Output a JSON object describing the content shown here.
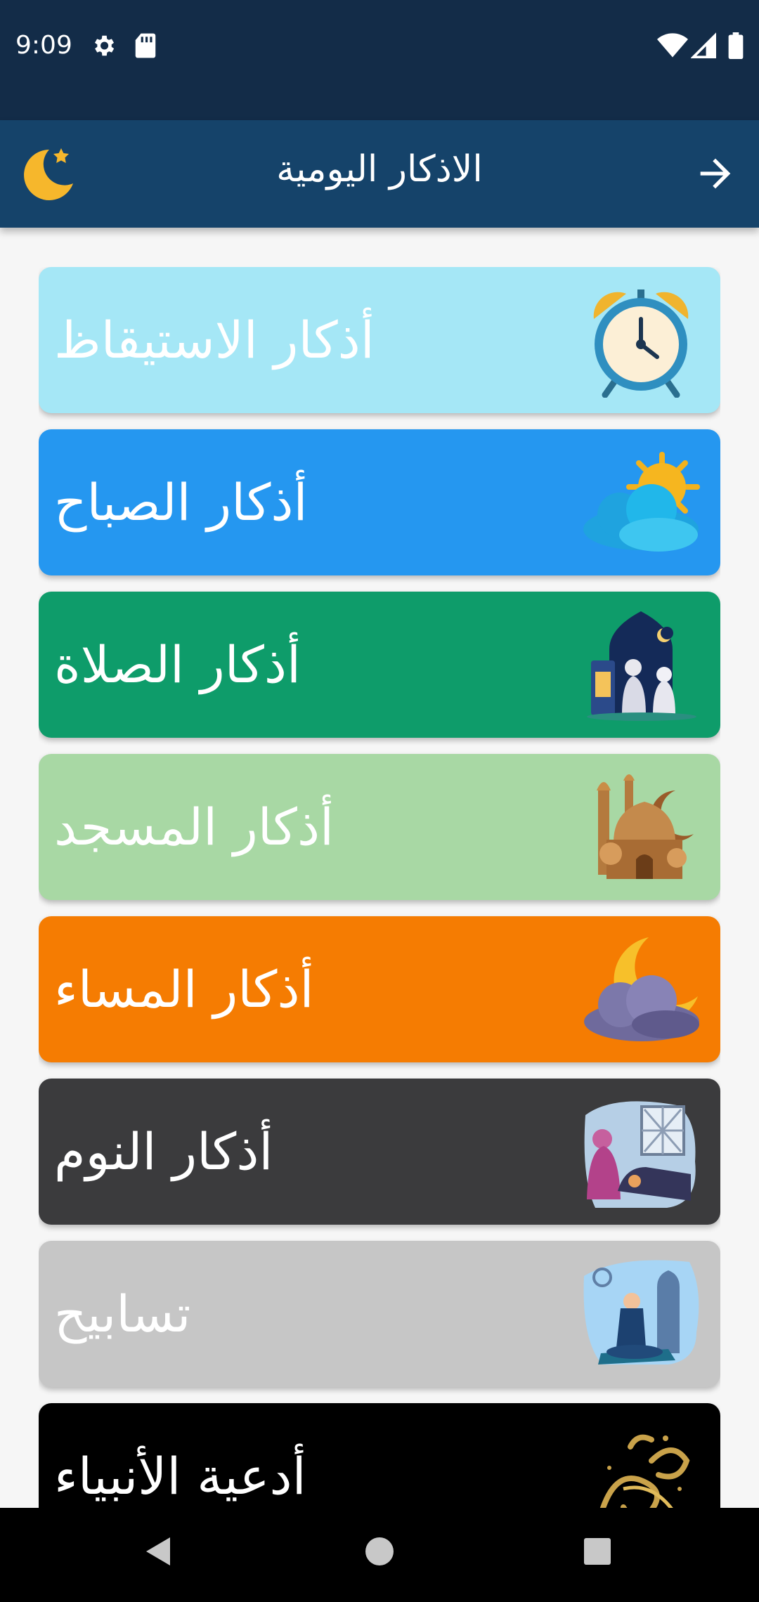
{
  "status_bar": {
    "time": "9:09",
    "icons": [
      "gear-icon",
      "sd-card-icon",
      "wifi-icon",
      "cellular-signal-icon",
      "battery-icon"
    ]
  },
  "app_bar": {
    "title": "الاذكار اليومية",
    "back_icon": "arrow-right-icon",
    "menu_icon": "crescent-star-icon",
    "background": "#15436a"
  },
  "categories": [
    {
      "label": "أذكار الاستيقاظ",
      "color": "#a5e7f6",
      "icon": "alarm-clock-icon"
    },
    {
      "label": "أذكار الصباح",
      "color": "#2597f0",
      "icon": "sun-cloud-icon"
    },
    {
      "label": "أذكار الصلاة",
      "color": "#0e9c6a",
      "icon": "praying-people-icon"
    },
    {
      "label": "أذكار المسجد",
      "color": "#a8d8a4",
      "icon": "mosque-icon"
    },
    {
      "label": "أذكار المساء",
      "color": "#f57c02",
      "icon": "moon-cloud-icon"
    },
    {
      "label": "أذكار النوم",
      "color": "#3b3b3d",
      "icon": "bedtime-icon"
    },
    {
      "label": "تسابيح",
      "color": "#c6c6c6",
      "icon": "man-praying-icon"
    },
    {
      "label": "أدعية الأنبياء",
      "color": "#000000",
      "icon": "calligraphy-icon"
    }
  ],
  "nav_bar": {
    "icons": [
      "back-triangle-icon",
      "home-circle-icon",
      "recents-square-icon"
    ]
  }
}
